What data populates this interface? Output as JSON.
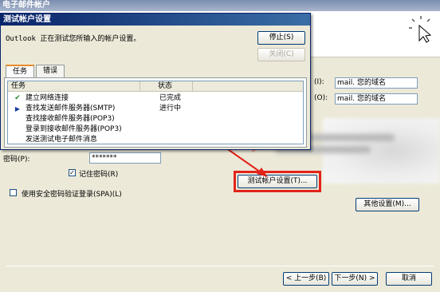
{
  "outer": {
    "title": "电子邮件帐户",
    "server_label_in": "(I):",
    "server_label_out": "(O):",
    "server_in_value": "mail. 您的域名",
    "server_out_value": "mail. 您的域名",
    "password_label": "密码(P):",
    "password_value": "*******",
    "remember_pw_label": "记住密码(R)",
    "remember_pw_checked": true,
    "spa_label": "使用安全密码验证登录(SPA)(L)",
    "spa_checked": false,
    "test_button": "测试帐户设置(T)...",
    "more_button": "其他设置(M)...",
    "back_button": "< 上一步(B)",
    "next_button": "下一步(N) >",
    "cancel_button": "取消"
  },
  "dialog": {
    "title": "测试帐户设置",
    "message": "Outlook 正在测试您所输入的帐户设置。",
    "stop_button": "停止(S)",
    "close_button": "关闭(C)",
    "tabs": [
      {
        "label": "任务",
        "active": true
      },
      {
        "label": "错误",
        "active": false
      }
    ],
    "columns": {
      "task": "任务",
      "status": "状态"
    },
    "tasks": [
      {
        "name": "建立网络连接",
        "status": "已完成",
        "icon": "check-icon"
      },
      {
        "name": "查找发送邮件服务器(SMTP)",
        "status": "进行中",
        "icon": "arrow-right-icon"
      },
      {
        "name": "查找接收邮件服务器(POP3)",
        "status": "",
        "icon": ""
      },
      {
        "name": "登录到接收邮件服务器(POP3)",
        "status": "",
        "icon": ""
      },
      {
        "name": "发送测试电子邮件消息",
        "status": "",
        "icon": ""
      }
    ]
  },
  "colors": {
    "highlight": "#e2231a",
    "dialog_title": "#0a246a"
  }
}
